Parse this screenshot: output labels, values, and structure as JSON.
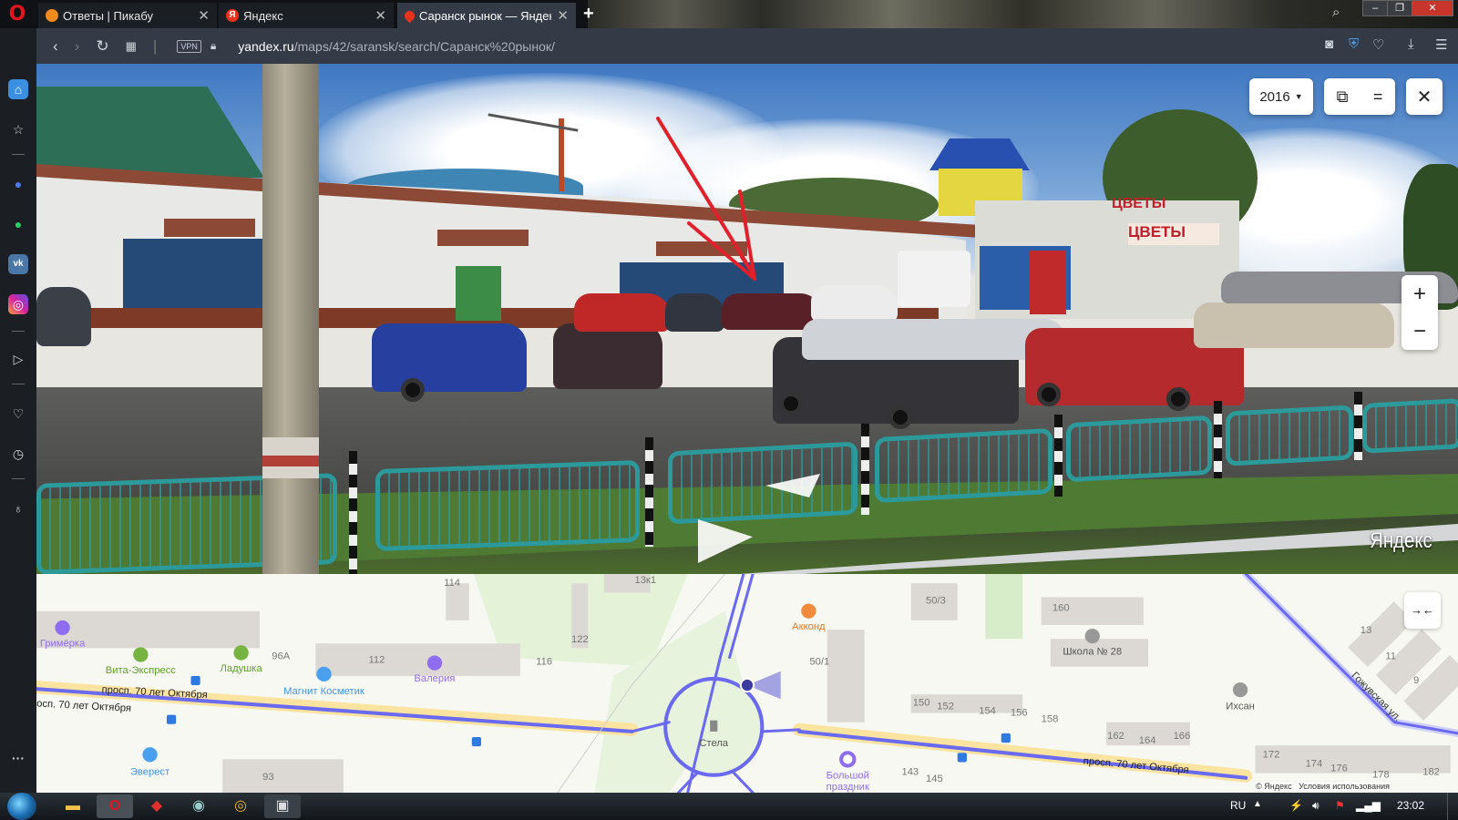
{
  "browser": {
    "tabs": [
      {
        "title": "Ответы | Пикабу",
        "favicon": "pikabu-icon",
        "active": false
      },
      {
        "title": "Яндекс",
        "favicon": "yandex-icon",
        "active": false
      },
      {
        "title": "Саранск рынок — Яндекс.Карты",
        "favicon": "map-pin-icon",
        "active": true
      }
    ],
    "new_tab": "+",
    "vpn_label": "VPN",
    "url_domain": "yandex.ru",
    "url_path": "/maps/42/saransk/search/Саранск%20рынок/"
  },
  "panorama": {
    "year": "2016",
    "watermark": "Яндекс",
    "zoom_in": "+",
    "zoom_out": "−",
    "sign_1": "ЦВЕТЫ",
    "sign_2": "ЦВЕТЫ"
  },
  "map": {
    "pois": [
      {
        "name": "Гримёрка",
        "color": "#8f6df0"
      },
      {
        "name": "Вита-Экспресс",
        "color": "#5ea02a"
      },
      {
        "name": "Ладушка",
        "color": "#5ea02a"
      },
      {
        "name": "Магнит Косметик",
        "color": "#3d93e8"
      },
      {
        "name": "Валерия",
        "color": "#8f6df0"
      },
      {
        "name": "Эверест",
        "color": "#3d93e8"
      },
      {
        "name": "Акконд",
        "color": "#e8781c"
      },
      {
        "name": "Школа № 28",
        "color": "#555555"
      },
      {
        "name": "Ихсан",
        "color": "#555555"
      },
      {
        "name": "Стела",
        "color": "#555555"
      },
      {
        "name": "Большой",
        "color": "#8f6df0"
      },
      {
        "name": "праздник",
        "color": "#8f6df0"
      }
    ],
    "streets": [
      "просп. 70 лет Октября",
      "осп. 70 лет Октября",
      "просп. 70 лет Октября",
      "Гожувская ул."
    ],
    "houses": [
      "114",
      "13к1",
      "122",
      "96А",
      "112",
      "116",
      "93",
      "50/3",
      "50/1",
      "160",
      "150",
      "152",
      "154",
      "156",
      "158",
      "162",
      "164",
      "166",
      "172",
      "174",
      "176",
      "178",
      "182",
      "143",
      "145",
      "13",
      "11",
      "9"
    ],
    "copyright": "© Яндекс",
    "terms": "Условия использования"
  },
  "taskbar": {
    "lang": "RU",
    "time": "23:02"
  }
}
